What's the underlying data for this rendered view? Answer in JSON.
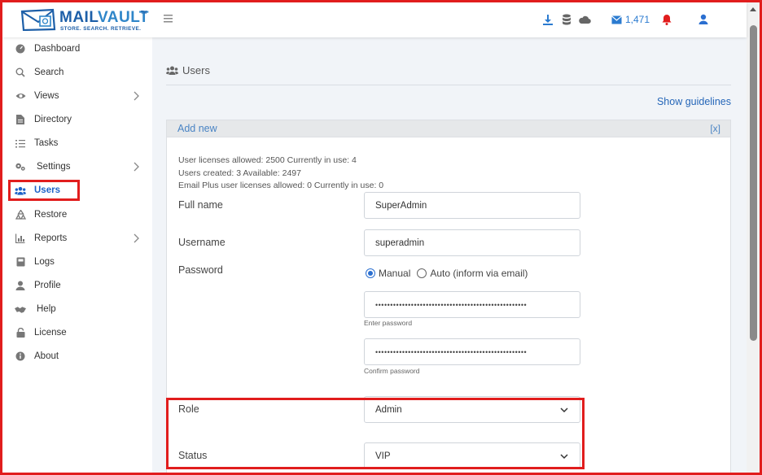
{
  "brand": {
    "name_part1": "MAIL",
    "name_part2": "VAULT",
    "tm": "TM",
    "tagline": "STORE. SEARCH. RETRIEVE."
  },
  "header": {
    "mail_count": "1,471",
    "icons": [
      "hamburger-icon",
      "download-icon",
      "database-icon",
      "cloud-icon",
      "envelope-icon",
      "bell-icon",
      "user-icon"
    ],
    "colors": {
      "accent": "#2b7bd0",
      "bell": "#e11d1d"
    }
  },
  "sidebar": {
    "items": [
      {
        "label": "Dashboard",
        "icon": "dashboard-icon"
      },
      {
        "label": "Search",
        "icon": "search-icon"
      },
      {
        "label": "Views",
        "icon": "eye-icon",
        "has_submenu": true
      },
      {
        "label": "Directory",
        "icon": "document-icon"
      },
      {
        "label": "Tasks",
        "icon": "tasks-icon"
      },
      {
        "label": "Settings",
        "icon": "gears-icon",
        "has_submenu": true
      },
      {
        "label": "Users",
        "icon": "users-icon",
        "active": true
      },
      {
        "label": "Restore",
        "icon": "recycle-icon"
      },
      {
        "label": "Reports",
        "icon": "chart-icon",
        "has_submenu": true
      },
      {
        "label": "Logs",
        "icon": "book-icon"
      },
      {
        "label": "Profile",
        "icon": "user-icon"
      },
      {
        "label": "Help",
        "icon": "handshake-icon"
      },
      {
        "label": "License",
        "icon": "lock-icon"
      },
      {
        "label": "About",
        "icon": "info-icon"
      }
    ]
  },
  "main": {
    "page_title": "Users",
    "show_guidelines": "Show guidelines",
    "panel": {
      "title": "Add new",
      "close": "[x]",
      "info": [
        "User licenses allowed: 2500   Currently in use: 4",
        "Users created: 3  Available: 2497",
        "Email Plus user licenses allowed: 0  Currently in use: 0"
      ],
      "form": {
        "full_name_label": "Full name",
        "full_name_value": "SuperAdmin",
        "username_label": "Username",
        "username_value": "superadmin",
        "password_label": "Password",
        "radio_manual": "Manual",
        "radio_auto": "Auto (inform via email)",
        "password_mask": "•••••••••••••••••••••••••••••••••••••••••••••••••••",
        "enter_password_hint": "Enter password",
        "confirm_password_mask": "•••••••••••••••••••••••••••••••••••••••••••••••••••",
        "confirm_password_hint": "Confirm password",
        "role_label": "Role",
        "role_value": "Admin",
        "status_label": "Status",
        "status_value": "VIP"
      }
    }
  }
}
